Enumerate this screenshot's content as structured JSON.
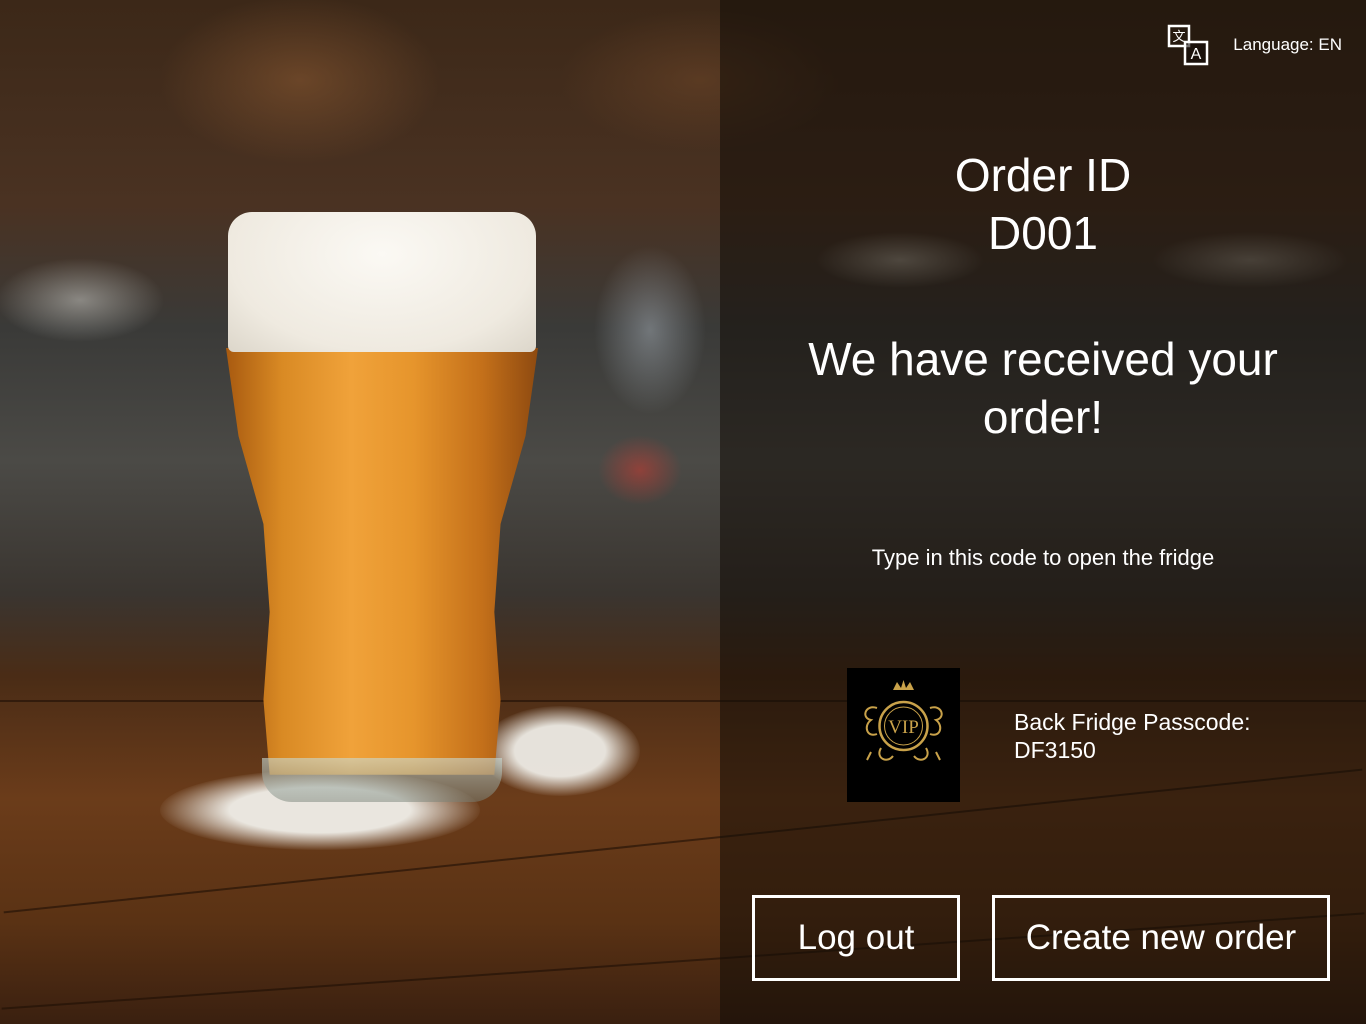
{
  "language": {
    "label": "Language: EN",
    "icon": "translate-icon"
  },
  "order": {
    "heading": "Order ID",
    "id": "D001"
  },
  "confirmation": {
    "message": "We have received your order!",
    "hint": "Type in this code to open the fridge"
  },
  "fridge": {
    "logo_text": "VIP",
    "passcode_label": "Back Fridge Passcode:",
    "passcode_value": "DF3150"
  },
  "actions": {
    "logout_label": "Log out",
    "new_order_label": "Create new order"
  },
  "colors": {
    "text": "#ffffff",
    "logo_gold": "#c9a24a",
    "panel_overlay": "rgba(18,12,8,0.55)"
  }
}
